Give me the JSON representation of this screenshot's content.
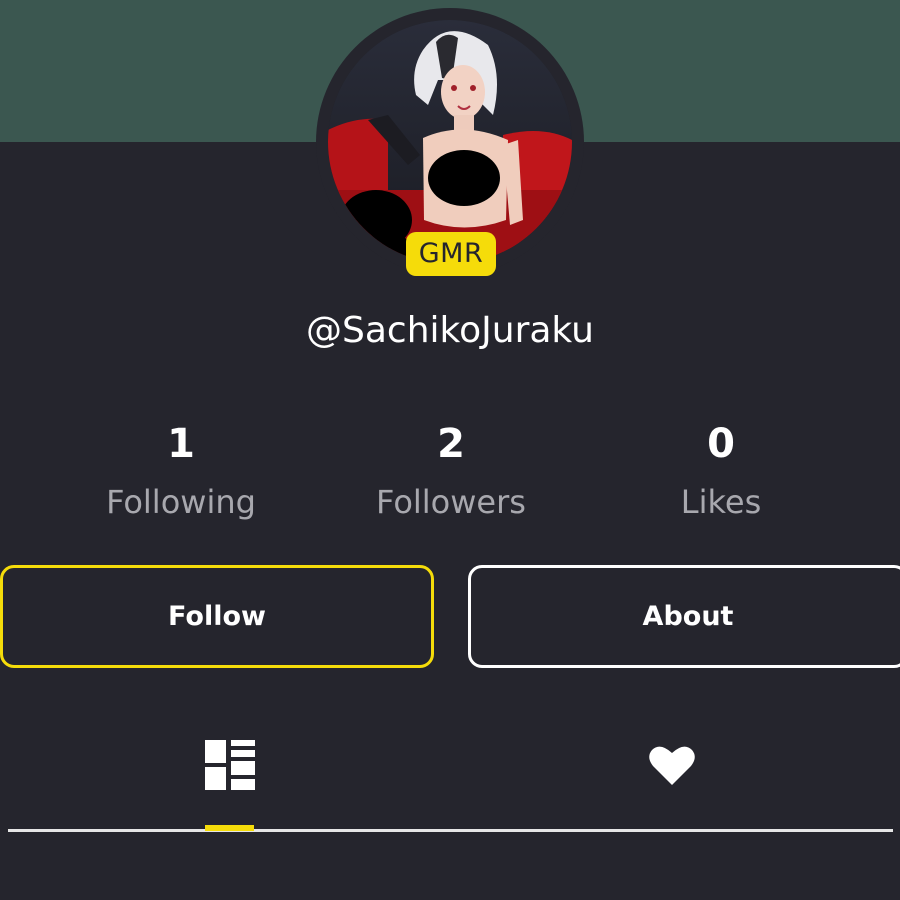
{
  "profile": {
    "username": "@SachikoJuraku",
    "badge": "GMR",
    "avatar_icon": "profile-avatar-image"
  },
  "stats": [
    {
      "value": "1",
      "label": "Following"
    },
    {
      "value": "2",
      "label": "Followers"
    },
    {
      "value": "0",
      "label": "Likes"
    }
  ],
  "buttons": {
    "follow": "Follow",
    "about": "About"
  },
  "tabs": {
    "grid_icon": "grid-icon",
    "likes_icon": "heart-icon",
    "active": "grid"
  },
  "colors": {
    "banner": "#3b5750",
    "background": "#25252d",
    "accent": "#f5dc0a",
    "text_muted": "#a8a8ae"
  }
}
